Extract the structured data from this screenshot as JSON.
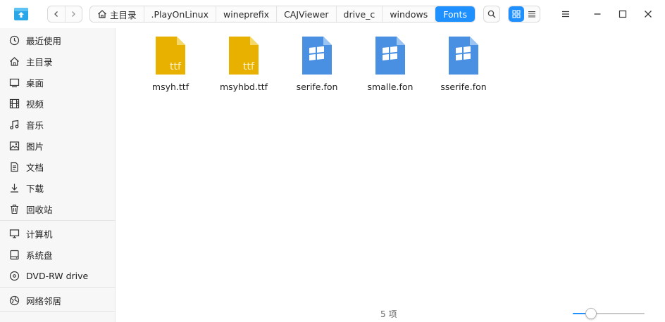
{
  "titlebar": {
    "breadcrumbs": [
      {
        "label": "主目录",
        "icon": "home-icon"
      },
      {
        "label": ".PlayOnLinux"
      },
      {
        "label": "wineprefix"
      },
      {
        "label": "CAJViewer"
      },
      {
        "label": "drive_c"
      },
      {
        "label": "windows"
      },
      {
        "label": "Fonts",
        "active": true
      }
    ],
    "view_mode": "icon"
  },
  "sidebar": {
    "items": [
      {
        "label": "最近使用",
        "icon": "clock-icon"
      },
      {
        "label": "主目录",
        "icon": "home-icon"
      },
      {
        "label": "桌面",
        "icon": "desktop-icon"
      },
      {
        "label": "视频",
        "icon": "video-icon"
      },
      {
        "label": "音乐",
        "icon": "music-icon"
      },
      {
        "label": "图片",
        "icon": "picture-icon"
      },
      {
        "label": "文档",
        "icon": "document-icon"
      },
      {
        "label": "下载",
        "icon": "download-icon"
      },
      {
        "label": "回收站",
        "icon": "trash-icon"
      },
      {
        "label": "计算机",
        "icon": "computer-icon"
      },
      {
        "label": "系统盘",
        "icon": "disk-icon"
      },
      {
        "label": "DVD-RW drive",
        "icon": "optical-drive-icon"
      },
      {
        "label": "网络邻居",
        "icon": "network-icon"
      }
    ]
  },
  "files": [
    {
      "name": "msyh.ttf",
      "type": "ttf",
      "badge": "ttf"
    },
    {
      "name": "msyhbd.ttf",
      "type": "ttf",
      "badge": "ttf"
    },
    {
      "name": "serife.fon",
      "type": "fon"
    },
    {
      "name": "smalle.fon",
      "type": "fon"
    },
    {
      "name": "sserife.fon",
      "type": "fon"
    }
  ],
  "status": {
    "item_count": "5 项"
  },
  "zoom": {
    "level": 0.25
  },
  "colors": {
    "accent": "#1e90ff",
    "ttf": "#e8b100",
    "fon": "#4a90e2"
  }
}
